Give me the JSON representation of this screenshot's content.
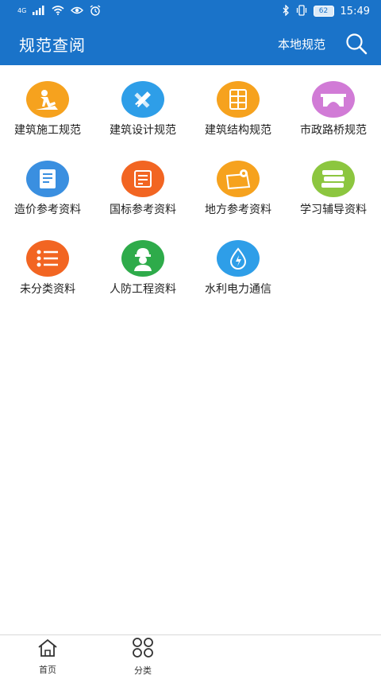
{
  "status_bar": {
    "network": "4G",
    "signal_icon": "signal-icon",
    "wifi_icon": "wifi-icon",
    "eye_icon": "eye-icon",
    "alarm_icon": "alarm-icon",
    "bluetooth_icon": "bluetooth-icon",
    "vibrate_icon": "vibrate-icon",
    "battery": "62",
    "time": "15:49"
  },
  "app_bar": {
    "title": "规范查阅",
    "local_link": "本地规范",
    "search_icon": "search-icon"
  },
  "categories": [
    {
      "label": "建筑施工规范",
      "icon": "worker-icon",
      "color": "#f6a21e"
    },
    {
      "label": "建筑设计规范",
      "icon": "ruler-pencil-icon",
      "color": "#2e9ee8"
    },
    {
      "label": "建筑结构规范",
      "icon": "building-grid-icon",
      "color": "#f6a21e"
    },
    {
      "label": "市政路桥规范",
      "icon": "bridge-icon",
      "color": "#d17bd6"
    },
    {
      "label": "造价参考资料",
      "icon": "document-icon",
      "color": "#3a8fe0"
    },
    {
      "label": "国标参考资料",
      "icon": "notepad-icon",
      "color": "#f26522"
    },
    {
      "label": "地方参考资料",
      "icon": "map-pin-icon",
      "color": "#f6a21e"
    },
    {
      "label": "学习辅导资料",
      "icon": "books-icon",
      "color": "#8cc63f"
    },
    {
      "label": "未分类资料",
      "icon": "list-icon",
      "color": "#f26522"
    },
    {
      "label": "人防工程资料",
      "icon": "helmet-worker-icon",
      "color": "#2eab4a"
    },
    {
      "label": "水利电力通信",
      "icon": "water-power-icon",
      "color": "#2e9ee8"
    }
  ],
  "bottom_nav": {
    "home_label": "首页",
    "category_label": "分类"
  },
  "colors": {
    "primary": "#1a73c9"
  }
}
